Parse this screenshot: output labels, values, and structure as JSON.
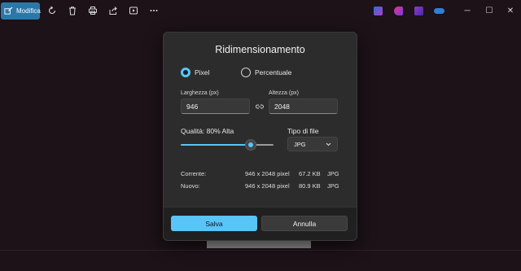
{
  "toolbar": {
    "edit_label": "Modifica",
    "icons": [
      "edit-icon",
      "rotate-icon",
      "delete-icon",
      "print-icon",
      "share-icon",
      "slideshow-icon",
      "more-icon"
    ]
  },
  "taskbar_apps": [
    "clipchamp-icon",
    "designer-icon",
    "video-editor-icon",
    "onedrive-icon"
  ],
  "window_controls": {
    "minimize": "─",
    "maximize": "☐",
    "close": "✕"
  },
  "dialog": {
    "title": "Ridimensionamento",
    "mode_options": [
      {
        "label": "Pixel",
        "selected": true
      },
      {
        "label": "Percentuale",
        "selected": false
      }
    ],
    "width_label": "Larghezza (px)",
    "width_value": "946",
    "height_label": "Altezza (px)",
    "height_value": "2048",
    "quality_label": "Qualità: 80% Alta",
    "quality_value": 80,
    "filetype_label": "Tipo di file",
    "filetype_value": "JPG",
    "current": {
      "label": "Corrente:",
      "dimensions": "946 x 2048 pixel",
      "size": "67.2 KB",
      "format": "JPG"
    },
    "new": {
      "label": "Nuovo:",
      "dimensions": "946 x 2048 pixel",
      "size": "80.9 KB",
      "format": "JPG"
    },
    "save_label": "Salva",
    "cancel_label": "Annulla"
  },
  "colors": {
    "accent": "#59c4f8",
    "edit_button": "#2b78a8",
    "background": "#1c1217"
  }
}
